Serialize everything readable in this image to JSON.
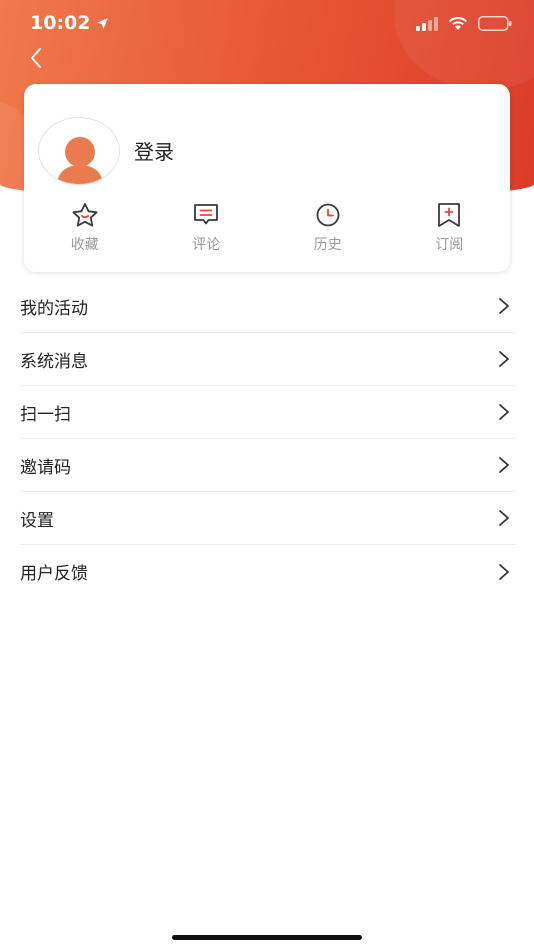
{
  "status_bar": {
    "time": "10:02"
  },
  "colors": {
    "accent": "#e95a36",
    "avatar": "#ea7b4f",
    "icon_stroke": "#3a3a3a",
    "icon_accent": "#e64a2e"
  },
  "profile": {
    "login_label": "登录"
  },
  "quick_actions": [
    {
      "label": "收藏",
      "icon": "star-icon"
    },
    {
      "label": "评论",
      "icon": "comment-icon"
    },
    {
      "label": "历史",
      "icon": "clock-icon"
    },
    {
      "label": "订阅",
      "icon": "bookmark-plus-icon"
    }
  ],
  "menu": [
    {
      "label": "我的活动"
    },
    {
      "label": "系统消息"
    },
    {
      "label": "扫一扫"
    },
    {
      "label": "邀请码"
    },
    {
      "label": "设置"
    },
    {
      "label": "用户反馈"
    }
  ]
}
